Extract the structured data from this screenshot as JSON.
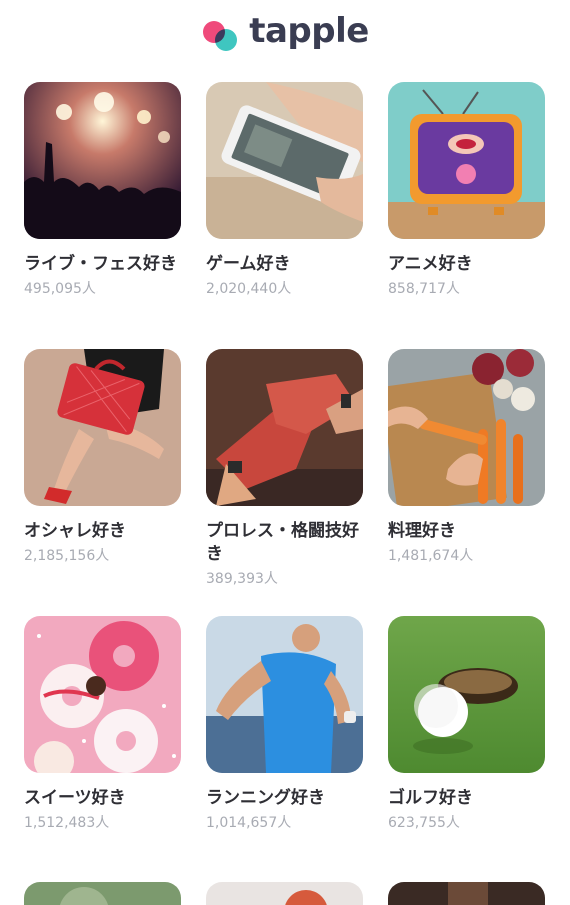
{
  "header": {
    "logo_text": "tapple"
  },
  "categories": [
    {
      "label": "ライブ・フェス好き",
      "count": "495,095人",
      "icon": "concert-photo"
    },
    {
      "label": "ゲーム好き",
      "count": "2,020,440人",
      "icon": "smartphone-game-photo"
    },
    {
      "label": "アニメ好き",
      "count": "858,717人",
      "icon": "retro-tv-photo"
    },
    {
      "label": "オシャレ好き",
      "count": "2,185,156人",
      "icon": "handbag-fashion-photo"
    },
    {
      "label": "プロレス・格闘技好き",
      "count": "389,393人",
      "icon": "boxing-wraps-photo"
    },
    {
      "label": "料理好き",
      "count": "1,481,674人",
      "icon": "cooking-carrots-photo"
    },
    {
      "label": "スイーツ好き",
      "count": "1,512,483人",
      "icon": "donuts-photo"
    },
    {
      "label": "ランニング好き",
      "count": "1,014,657人",
      "icon": "runner-photo"
    },
    {
      "label": "ゴルフ好き",
      "count": "623,755人",
      "icon": "golf-ball-photo"
    }
  ],
  "colors": {
    "logo_pink": "#ef4a7b",
    "logo_teal": "#3fc6c0",
    "logo_text": "#3a3d52",
    "count_gray": "#a8abb3"
  }
}
